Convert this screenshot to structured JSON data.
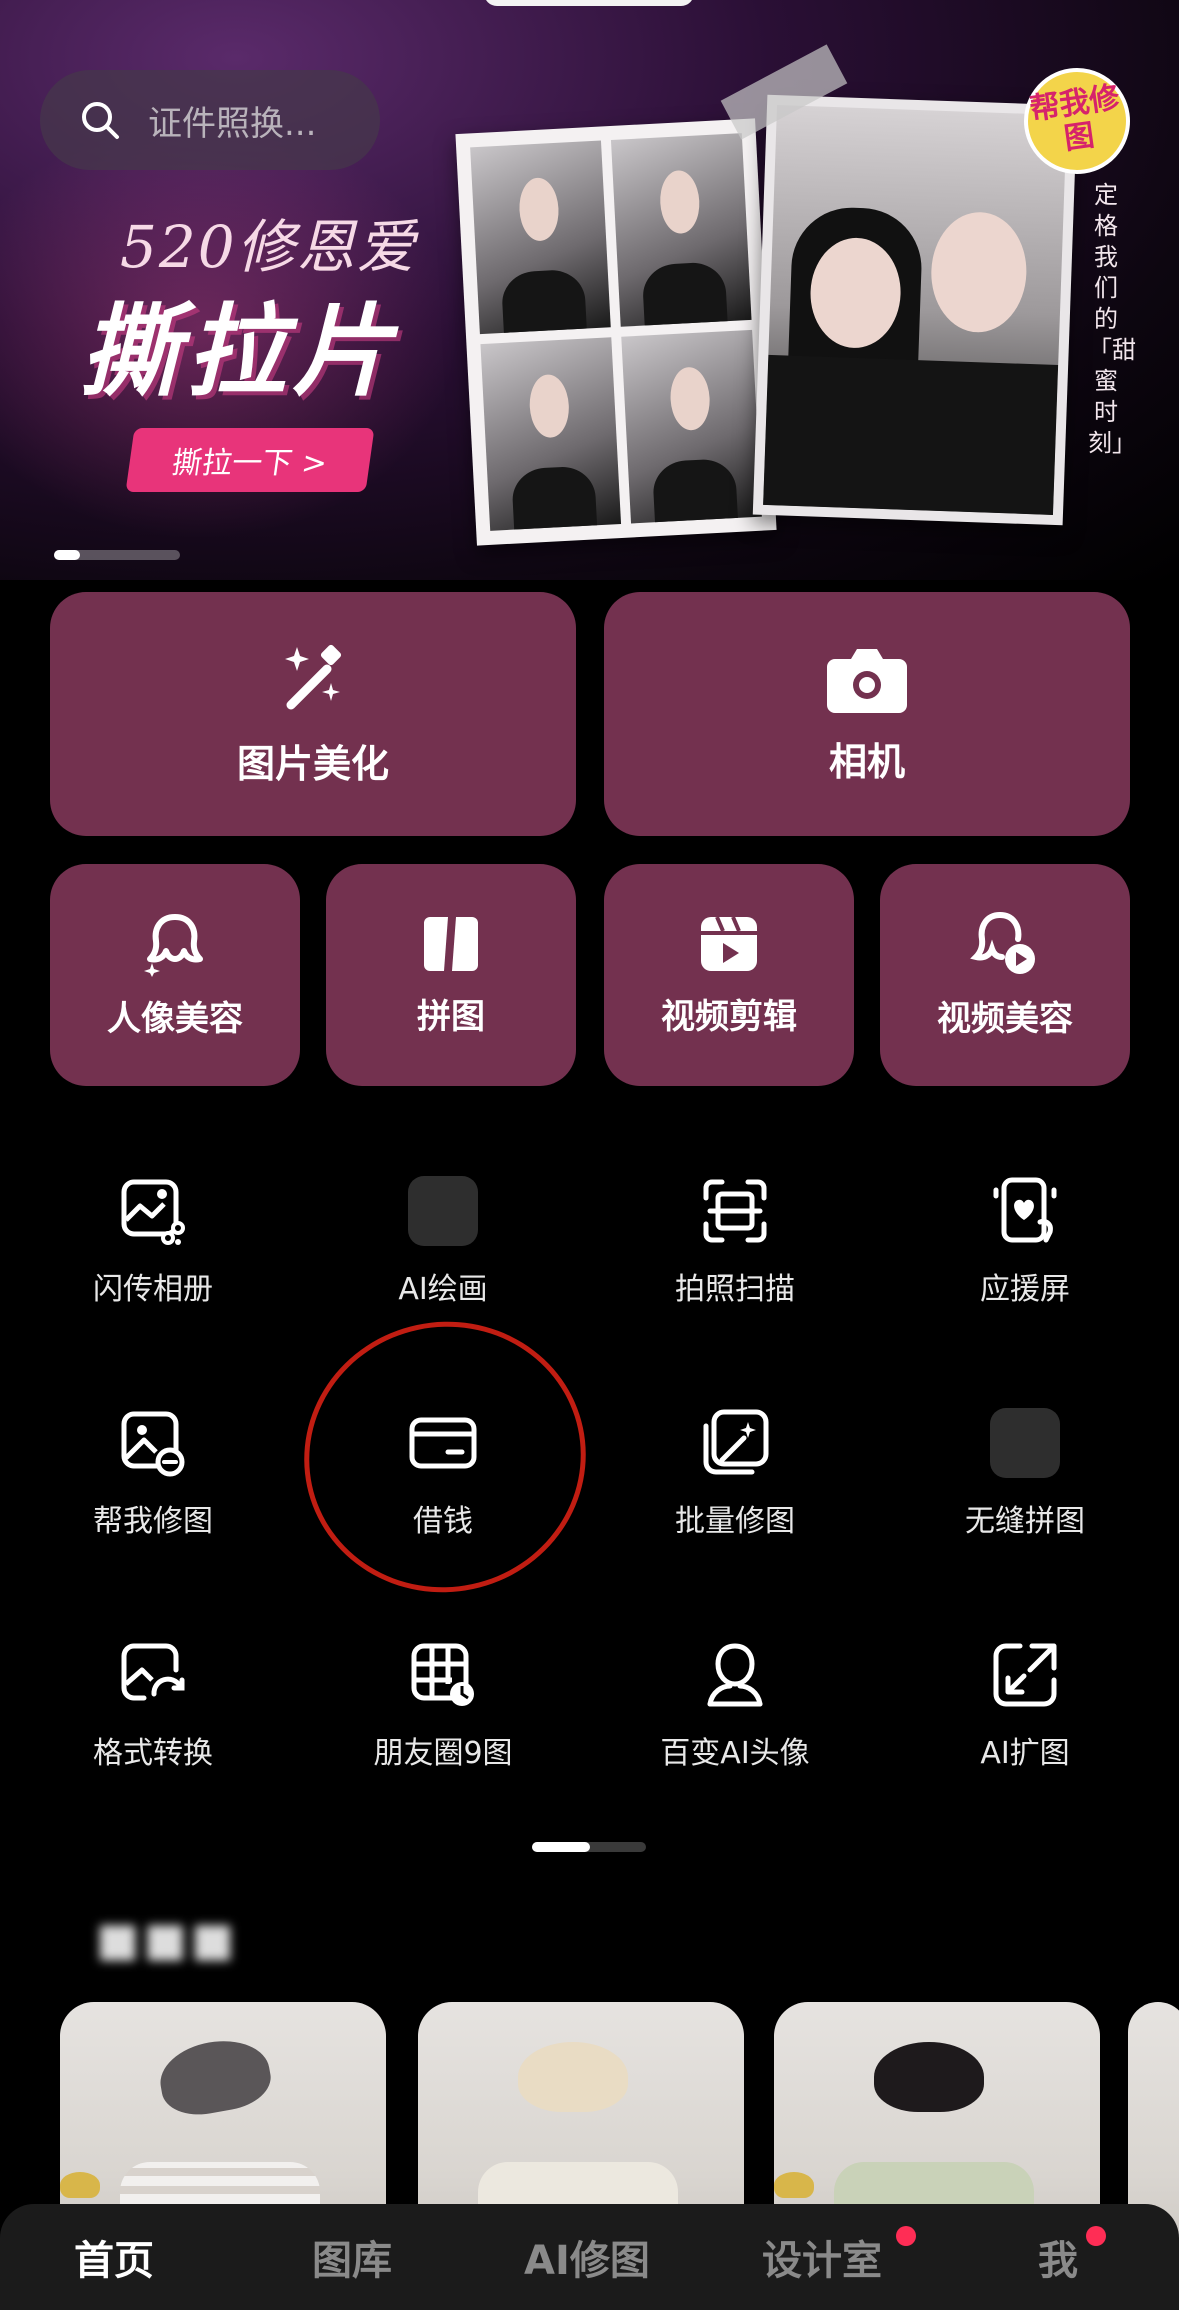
{
  "search": {
    "placeholder": "证件照换..."
  },
  "banner": {
    "title_line1": "520修恩爱",
    "title_line2": "撕拉片",
    "cta_label": "撕拉一下 >",
    "badge": "帮我修图",
    "vertical_text": "定格我们的「甜蜜时刻」"
  },
  "big_tiles": [
    {
      "label": "图片美化",
      "icon": "magic-wand-icon"
    },
    {
      "label": "相机",
      "icon": "camera-icon"
    }
  ],
  "small_tiles": [
    {
      "label": "人像美容",
      "icon": "portrait-sparkle-icon"
    },
    {
      "label": "拼图",
      "icon": "collage-icon"
    },
    {
      "label": "视频剪辑",
      "icon": "video-clapper-icon"
    },
    {
      "label": "视频美容",
      "icon": "video-portrait-icon"
    }
  ],
  "tools": [
    {
      "label": "闪传相册",
      "icon": "album-share-icon"
    },
    {
      "label": "AI绘画",
      "icon": "placeholder-icon"
    },
    {
      "label": "拍照扫描",
      "icon": "scan-icon"
    },
    {
      "label": "应援屏",
      "icon": "phone-heart-icon"
    },
    {
      "label": "帮我修图",
      "icon": "retouch-help-icon"
    },
    {
      "label": "借钱",
      "icon": "card-icon"
    },
    {
      "label": "批量修图",
      "icon": "batch-edit-icon"
    },
    {
      "label": "无缝拼图",
      "icon": "placeholder-icon"
    },
    {
      "label": "格式转换",
      "icon": "format-convert-icon"
    },
    {
      "label": "朋友圈9图",
      "icon": "grid-nine-icon"
    },
    {
      "label": "百变AI头像",
      "icon": "ai-avatar-icon"
    },
    {
      "label": "AI扩图",
      "icon": "expand-icon"
    }
  ],
  "nav": [
    {
      "label": "首页",
      "active": true
    },
    {
      "label": "图库",
      "active": false
    },
    {
      "label": "AI修图",
      "active": false
    },
    {
      "label": "设计室",
      "active": false,
      "dot": true
    },
    {
      "label": "我",
      "active": false,
      "dot": true
    }
  ],
  "colors": {
    "tile": "#73314f",
    "accent": "#e8347a",
    "notification_dot": "#ff2d55",
    "annotation_circle": "#c11d12"
  }
}
